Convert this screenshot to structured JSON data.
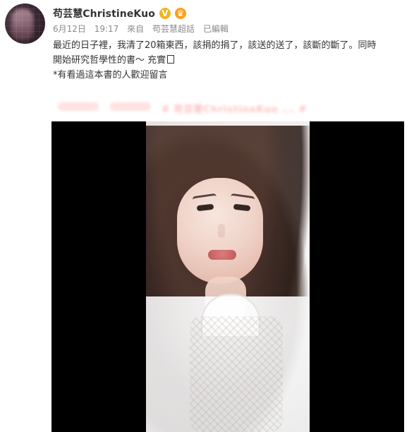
{
  "post": {
    "username": "苟芸慧ChristineKuo",
    "badges": {
      "verified_text": "V",
      "crown_text": "♛"
    },
    "meta": {
      "date": "6月12日",
      "time": "19:17",
      "source_prefix": "來自",
      "source_name": "苟芸慧超話",
      "edited": "已編輯"
    },
    "text_lines": [
      "最近的日子裡，我清了20箱東西，該捐的捐了，該送的送了，該斷的斷了。同時",
      "開始研究哲學性的書～ 充實",
      "*有看過這本書的人歡迎留言"
    ],
    "blurred_line_text": "# 苟芸慧ChristineKuo ... #"
  }
}
